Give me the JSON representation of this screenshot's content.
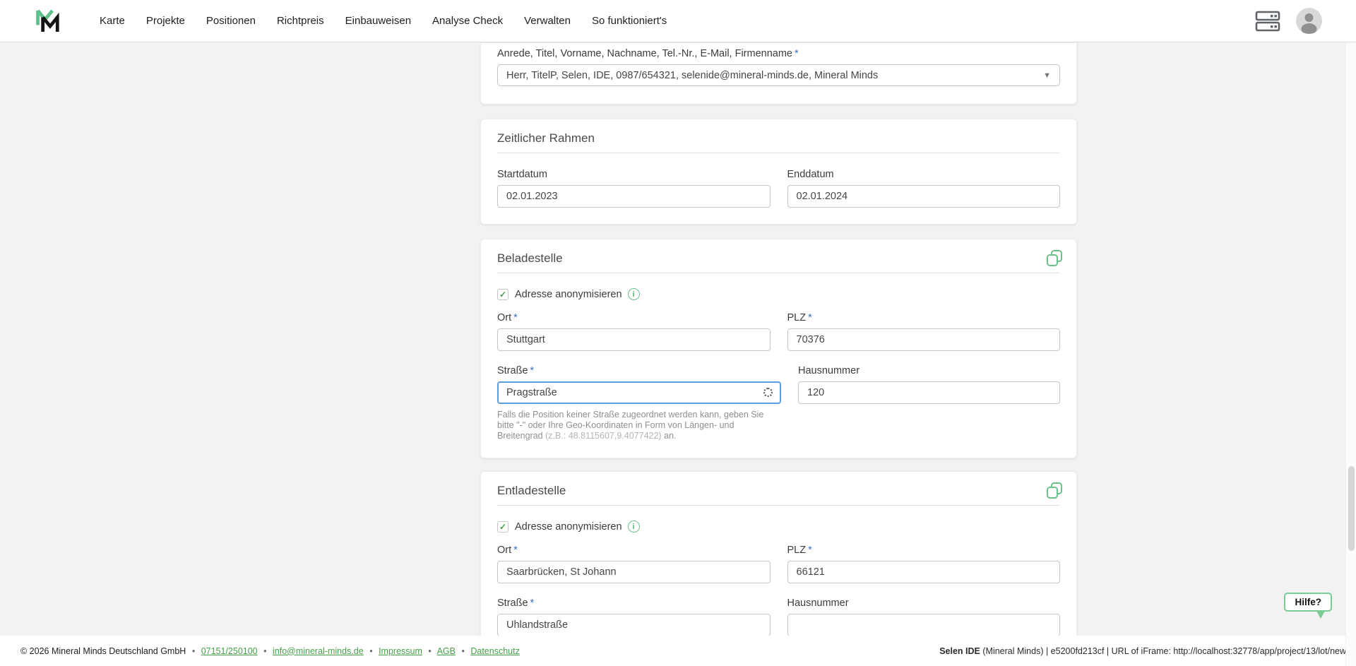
{
  "colors": {
    "accent_green_light": "#6cc08b",
    "accent_green_dark": "#43a047",
    "required_blue": "#3f6fbf",
    "focus_blue": "#5e9de0",
    "page_bg": "#f2f2f2"
  },
  "nav": {
    "items": [
      "Karte",
      "Projekte",
      "Positionen",
      "Richtpreis",
      "Einbauweisen",
      "Analyse Check",
      "Verwalten",
      "So funktioniert's"
    ],
    "right_icons": [
      "server-icon",
      "user-avatar-icon"
    ]
  },
  "icons": {
    "checkbox_check": "✓",
    "select_caret": "▼",
    "info_glyph": "i"
  },
  "required_mark": "*",
  "contact": {
    "label": "Anrede, Titel, Vorname, Nachname, Tel.-Nr., E-Mail, Firmenname",
    "value": "Herr, TitelP, Selen, IDE, 0987/654321, selenide@mineral-minds.de, Mineral Minds"
  },
  "timeframe": {
    "title": "Zeitlicher Rahmen",
    "start_label": "Startdatum",
    "start_value": "02.01.2023",
    "end_label": "Enddatum",
    "end_value": "02.01.2024"
  },
  "address_labels": {
    "anonymize": "Adresse anonymisieren",
    "ort": "Ort",
    "plz": "PLZ",
    "strasse": "Straße",
    "hausnummer": "Hausnummer",
    "helper_prefix": "Falls die Position keiner Straße zugeordnet werden kann, geben Sie bitte \"-\" oder Ihre Geo-Koordinaten in Form von Längen- und Breitengrad ",
    "helper_example": "(z.B.: 48.8115607,9.4077422)",
    "helper_suffix": " an."
  },
  "beladestelle": {
    "title": "Beladestelle",
    "anonymize_checked": true,
    "ort": "Stuttgart",
    "plz": "70376",
    "strasse": "Pragstraße",
    "hausnummer": "120"
  },
  "entladestelle": {
    "title": "Entladestelle",
    "anonymize_checked": true,
    "ort": "Saarbrücken, St Johann",
    "plz": "66121",
    "strasse": "Uhlandstraße",
    "hausnummer": ""
  },
  "help": {
    "label": "Hilfe?"
  },
  "footer": {
    "copyright": "© 2026 Mineral Minds Deutschland GmbH",
    "separator": "•",
    "links": [
      "07151/250100",
      "info@mineral-minds.de",
      "Impressum",
      "AGB",
      "Datenschutz"
    ],
    "right_bold": "Selen IDE",
    "right_rest": " (Mineral Minds) | e5200fd213cf | URL of iFrame: http://localhost:32778/app/project/13/lot/new"
  }
}
